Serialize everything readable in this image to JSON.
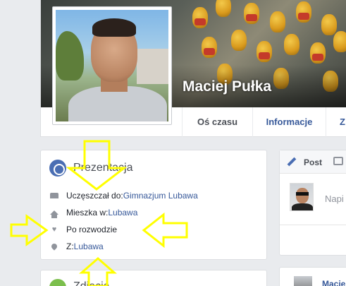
{
  "profile": {
    "name": "Maciej Pułka"
  },
  "tabs": [
    {
      "label": "Oś czasu"
    },
    {
      "label": "Informacje"
    },
    {
      "label": "Z"
    }
  ],
  "intro": {
    "title": "Prezentacja",
    "rows": [
      {
        "prefix": "Uczęszczał do: ",
        "link": "Gimnazjum Lubawa",
        "icon": "school-icon"
      },
      {
        "prefix": "Mieszka w: ",
        "link": "Lubawa",
        "icon": "house-icon"
      },
      {
        "prefix": "Po rozwodzie",
        "link": "",
        "icon": "heart-icon"
      },
      {
        "prefix": "Z: ",
        "link": "Lubawa",
        "icon": "location-pin-icon"
      }
    ]
  },
  "photos": {
    "title": "Zdjęcia"
  },
  "composer": {
    "post_label": "Post",
    "placeholder": "Napi"
  },
  "feed": {
    "author_partial": "Macie"
  },
  "annotation": {
    "arrow_color": "#ffff00"
  }
}
